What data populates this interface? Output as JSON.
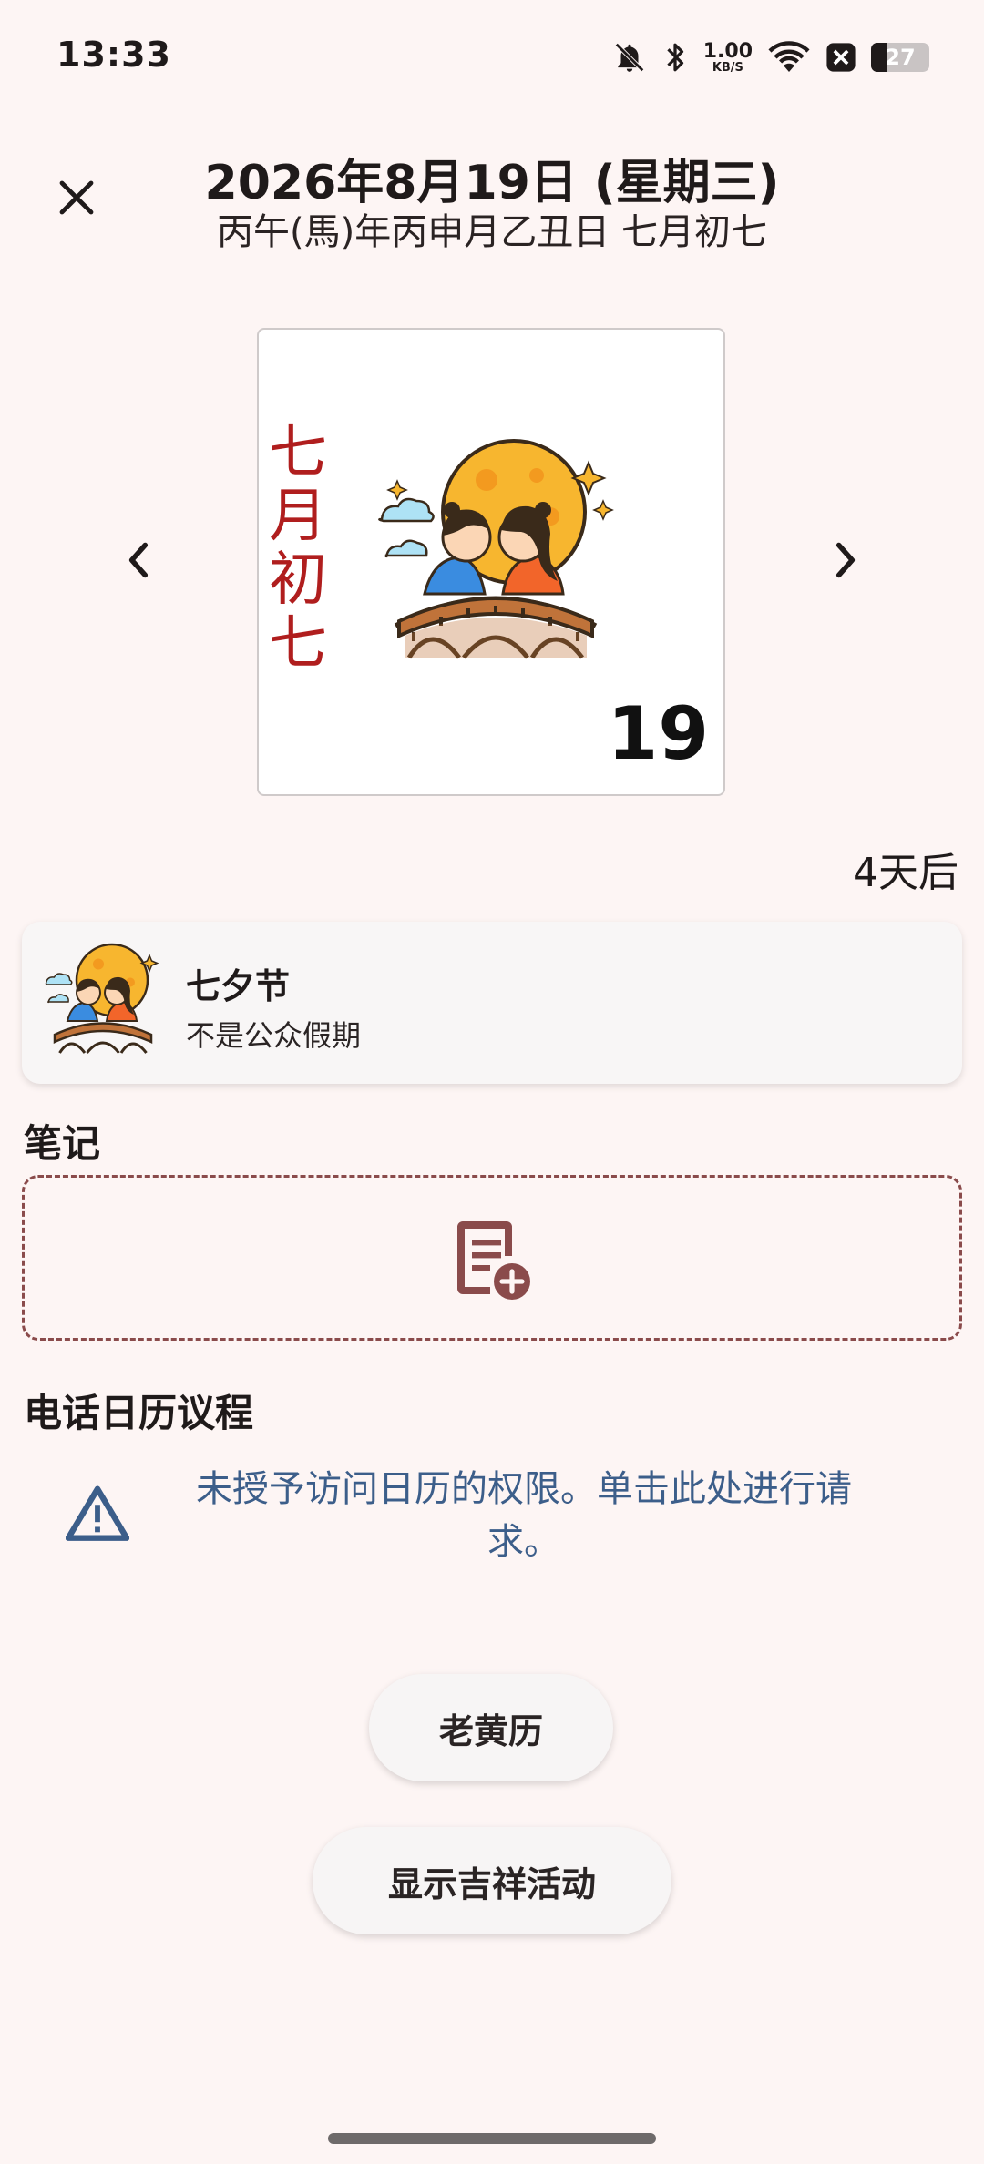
{
  "status_bar": {
    "time": "13:33",
    "net_speed_value": "1.00",
    "net_speed_unit": "KB/S",
    "battery_level": "27"
  },
  "header": {
    "title": "2026年8月19日 (星期三)",
    "subtitle": "丙午(馬)年丙申月乙丑日 七月初七"
  },
  "calendar_card": {
    "lunar_chars": [
      "七",
      "月",
      "初",
      "七"
    ],
    "day_number": "19"
  },
  "days_after": "4天后",
  "holiday": {
    "name": "七夕节",
    "description": "不是公众假期"
  },
  "notes": {
    "section_title": "笔记"
  },
  "agenda": {
    "section_title": "电话日历议程",
    "permission_text": "未授予访问日历的权限。单击此处进行请求。"
  },
  "buttons": {
    "almanac": "老黄历",
    "auspicious": "显示吉祥活动"
  },
  "colors": {
    "background": "#FDF5F4",
    "lunar_red": "#B01E1E",
    "link_blue": "#3C5E8A",
    "note_border": "#8A4B4B"
  }
}
